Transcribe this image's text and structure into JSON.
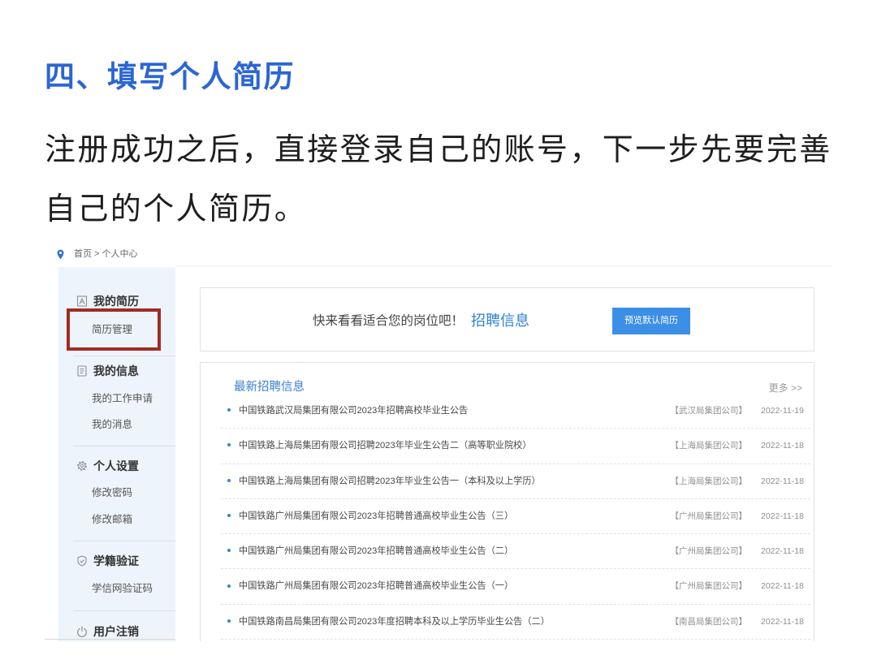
{
  "article": {
    "heading": "四、填写个人简历",
    "paragraph_lines": [
      "注册成功之后，直接登录自己的账号，下一步先要完善",
      "自己的个人简历。"
    ]
  },
  "site": {
    "breadcrumb": {
      "icon": "location-pin-icon",
      "text": "首页 > 个人中心"
    },
    "sidebar": {
      "groups": [
        {
          "title": "我的简历",
          "icon": "resume-icon",
          "items": [
            {
              "label": "简历管理",
              "highlighted": true
            }
          ]
        },
        {
          "title": "我的信息",
          "icon": "document-icon",
          "items": [
            {
              "label": "我的工作申请"
            },
            {
              "label": "我的消息"
            }
          ]
        },
        {
          "title": "个人设置",
          "icon": "gear-icon",
          "items": [
            {
              "label": "修改密码"
            },
            {
              "label": "修改邮箱"
            }
          ]
        },
        {
          "title": "学籍验证",
          "icon": "shield-check-icon",
          "items": [
            {
              "label": "学信网验证码"
            }
          ]
        },
        {
          "title": "用户注销",
          "icon": "power-icon",
          "items": []
        }
      ]
    },
    "promo": {
      "text": "快来看看适合您的岗位吧！",
      "link": "招聘信息",
      "button": "预览默认简历"
    },
    "jobs": {
      "title": "最新招聘信息",
      "more": "更多 >>",
      "items": [
        {
          "title": "中国铁路武汉局集团有限公司2023年招聘高校毕业生公告",
          "source": "【武汉局集团公司】",
          "date": "2022-11-19"
        },
        {
          "title": "中国铁路上海局集团有限公司招聘2023年毕业生公告二（高等职业院校）",
          "source": "【上海局集团公司】",
          "date": "2022-11-18"
        },
        {
          "title": "中国铁路上海局集团有限公司招聘2023年毕业生公告一（本科及以上学历）",
          "source": "【上海局集团公司】",
          "date": "2022-11-18"
        },
        {
          "title": "中国铁路广州局集团有限公司2023年招聘普通高校毕业生公告（三）",
          "source": "【广州局集团公司】",
          "date": "2022-11-18"
        },
        {
          "title": "中国铁路广州局集团有限公司2023年招聘普通高校毕业生公告（二）",
          "source": "【广州局集团公司】",
          "date": "2022-11-18"
        },
        {
          "title": "中国铁路广州局集团有限公司2023年招聘普通高校毕业生公告（一）",
          "source": "【广州局集团公司】",
          "date": "2022-11-18"
        },
        {
          "title": "中国铁路南昌局集团有限公司2023年度招聘本科及以上学历毕业生公告（二）",
          "source": "【南昌局集团公司】",
          "date": "2022-11-18"
        }
      ]
    }
  },
  "colors": {
    "heading": "#2b65d5",
    "accent_blue": "#2f80d6",
    "button": "#3c8fe6",
    "highlight_box": "#9f2c24",
    "sidebar_background": "#edf4fb"
  }
}
